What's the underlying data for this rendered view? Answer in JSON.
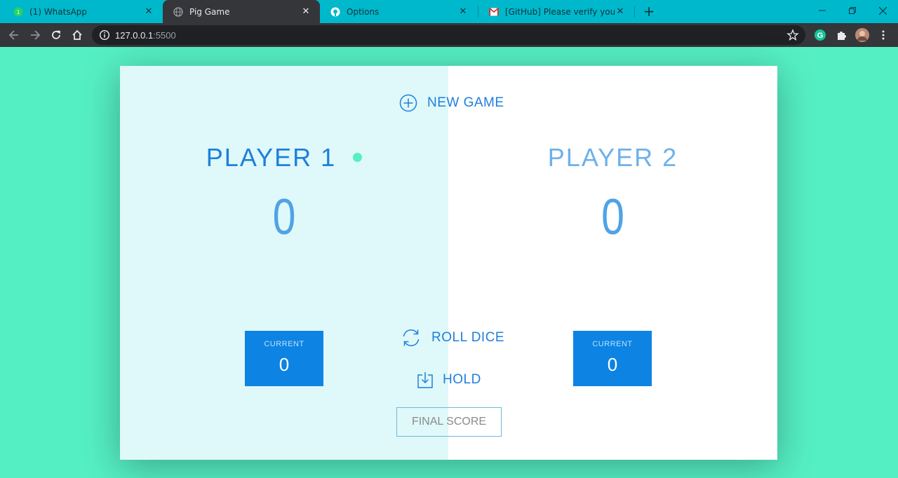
{
  "browser": {
    "tabs": [
      {
        "title": "(1) WhatsApp",
        "icon": "whatsapp-icon",
        "active": false
      },
      {
        "title": "Pig Game",
        "icon": "globe-icon",
        "active": true
      },
      {
        "title": "Options",
        "icon": "github-icon",
        "active": false
      },
      {
        "title": "[GitHub] Please verify your device",
        "icon": "gmail-icon",
        "active": false
      }
    ],
    "address": {
      "host": "127.0.0.1",
      "port": ":5500"
    },
    "extensions": [
      "grammarly-icon",
      "puzzle-icon",
      "avatar",
      "kebab-menu-icon"
    ]
  },
  "game": {
    "buttons": {
      "new_game": "NEW GAME",
      "roll_dice": "ROLL DICE",
      "hold": "HOLD"
    },
    "final_score_placeholder": "FINAL SCORE",
    "players": [
      {
        "name": "PLAYER 1",
        "score": "0",
        "current_label": "CURRENT",
        "current_score": "0",
        "active": true
      },
      {
        "name": "PLAYER 2",
        "score": "0",
        "current_label": "CURRENT",
        "current_score": "0",
        "active": false
      }
    ]
  },
  "colors": {
    "background": "#55efc4",
    "accent": "#0d83e3",
    "active_panel": "#dff8f9",
    "active_dot": "#55efc4",
    "tabstrip": "#00b8cc"
  }
}
